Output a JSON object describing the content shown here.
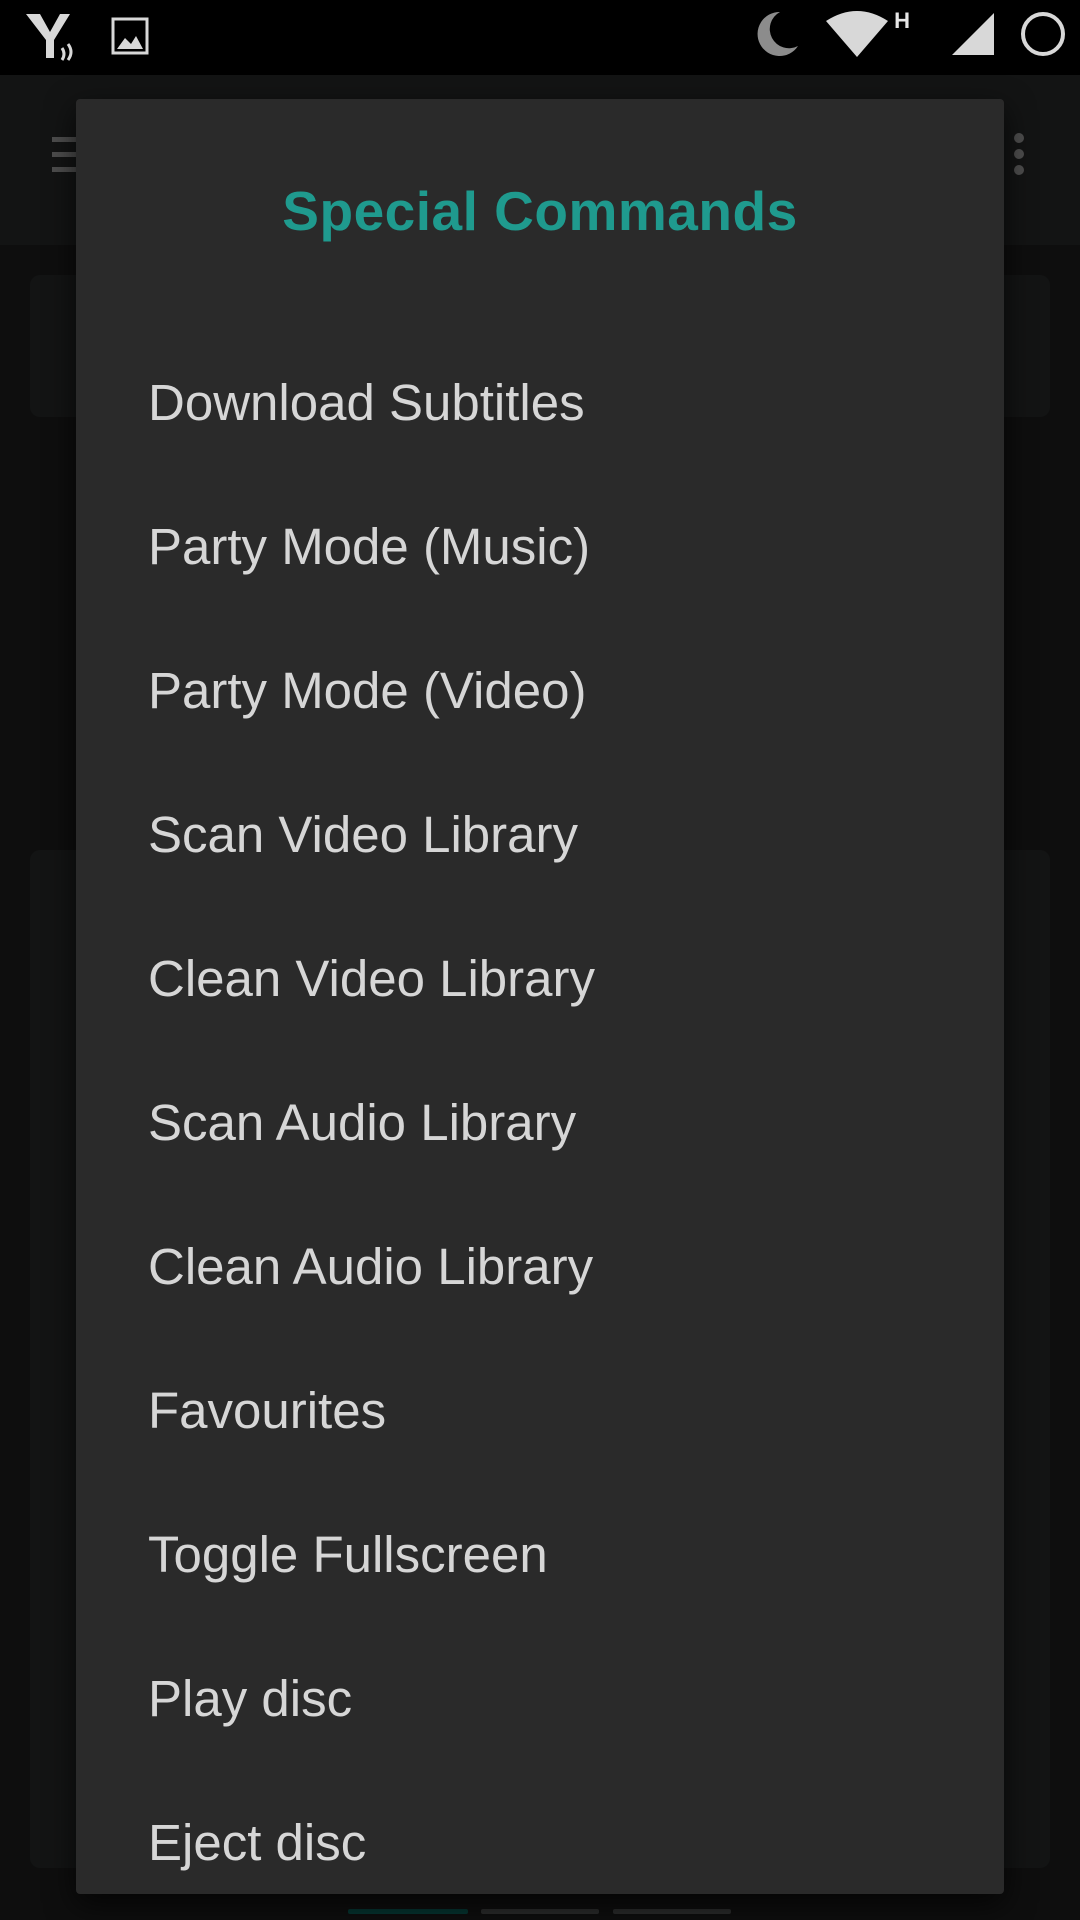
{
  "status_bar": {
    "left_icons": [
      "app-logo-icon",
      "image-notification-icon"
    ],
    "right_icons": [
      "moon-icon",
      "wifi-icon",
      "cellular-signal-icon",
      "loading-ring-icon"
    ],
    "network_type": "H"
  },
  "dialog": {
    "title": "Special Commands",
    "items": [
      {
        "label": "Download Subtitles"
      },
      {
        "label": "Party Mode (Music)"
      },
      {
        "label": "Party Mode (Video)"
      },
      {
        "label": "Scan Video Library"
      },
      {
        "label": "Clean Video Library"
      },
      {
        "label": "Scan Audio Library"
      },
      {
        "label": "Clean Audio Library"
      },
      {
        "label": "Favourites"
      },
      {
        "label": "Toggle Fullscreen"
      },
      {
        "label": "Play disc"
      },
      {
        "label": "Eject disc"
      }
    ]
  },
  "colors": {
    "accent": "#1f9a8e",
    "dialog_background": "#2a2a2a",
    "item_text": "#d6d6d6",
    "status_bar": "#000000"
  }
}
